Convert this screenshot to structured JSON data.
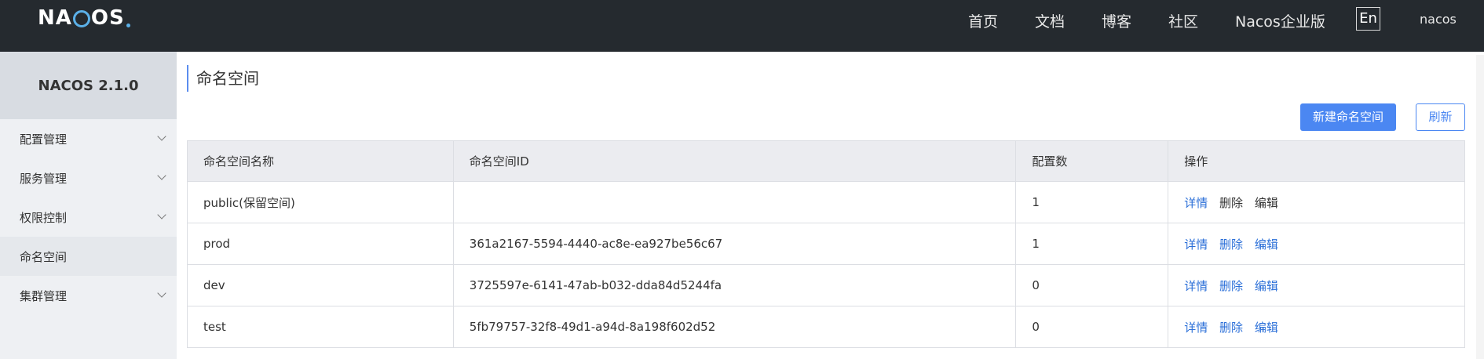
{
  "header": {
    "logo": {
      "pre": "NA",
      "post": "OS"
    },
    "nav": [
      "首页",
      "文档",
      "博客",
      "社区",
      "Nacos企业版"
    ],
    "lang": "En",
    "user": "nacos"
  },
  "sidebar": {
    "version": "NACOS 2.1.0",
    "items": [
      {
        "label": "配置管理",
        "expandable": true
      },
      {
        "label": "服务管理",
        "expandable": true
      },
      {
        "label": "权限控制",
        "expandable": true
      },
      {
        "label": "命名空间",
        "expandable": false,
        "active": true
      },
      {
        "label": "集群管理",
        "expandable": true
      }
    ]
  },
  "main": {
    "title": "命名空间",
    "buttons": {
      "create": "新建命名空间",
      "refresh": "刷新"
    },
    "table": {
      "headers": [
        "命名空间名称",
        "命名空间ID",
        "配置数",
        "操作"
      ],
      "rows": [
        {
          "name": "public(保留空间)",
          "id": "",
          "count": "1",
          "ops": [
            "详情",
            "删除",
            "编辑"
          ],
          "ops_disabled": [
            false,
            true,
            true
          ]
        },
        {
          "name": "prod",
          "id": "361a2167-5594-4440-ac8e-ea927be56c67",
          "count": "1",
          "ops": [
            "详情",
            "删除",
            "编辑"
          ],
          "ops_disabled": [
            false,
            false,
            false
          ]
        },
        {
          "name": "dev",
          "id": "3725597e-6141-47ab-b032-dda84d5244fa",
          "count": "0",
          "ops": [
            "详情",
            "删除",
            "编辑"
          ],
          "ops_disabled": [
            false,
            false,
            false
          ]
        },
        {
          "name": "test",
          "id": "5fb79757-32f8-49d1-a94d-8a198f602d52",
          "count": "0",
          "ops": [
            "详情",
            "删除",
            "编辑"
          ],
          "ops_disabled": [
            false,
            false,
            false
          ]
        }
      ]
    }
  },
  "colors": {
    "header_bg": "#252a2f",
    "primary": "#4b87f2",
    "link": "#2b6fd8",
    "sidebar_bg": "#eef0f3"
  },
  "icons": {
    "logo_ring": "logo-ring",
    "chevron": "chevron-down-icon"
  }
}
